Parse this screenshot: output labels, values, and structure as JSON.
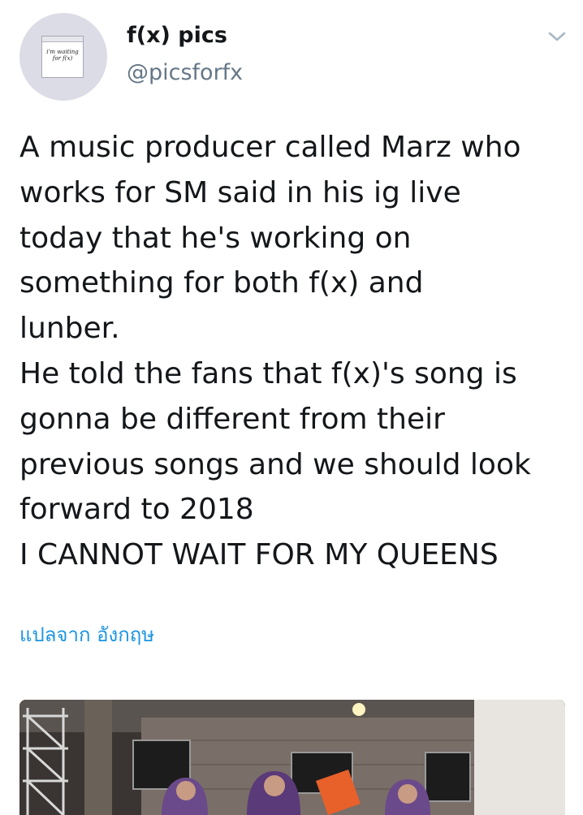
{
  "author": {
    "display_name": "f(x) pics",
    "handle": "@picsforfx",
    "avatar_text": "i'm waiting for f(x)"
  },
  "tweet": {
    "lines": [
      "A music producer called Marz who",
      "works for SM said in his ig live",
      "today that he's working on",
      "something for both f(x) and",
      "lunber.",
      "He told the fans that f(x)'s song is",
      "gonna be different from their",
      "previous songs and we should look",
      "forward to 2018",
      "I CANNOT WAIT FOR MY QUEENS"
    ]
  },
  "translate": {
    "label": "แปลจาก อังกฤษ"
  },
  "icons": {
    "menu": "chevron-down-icon"
  },
  "colors": {
    "text": "#14171a",
    "handle": "#657786",
    "link": "#1b95e0",
    "caret": "#aab8c2"
  }
}
